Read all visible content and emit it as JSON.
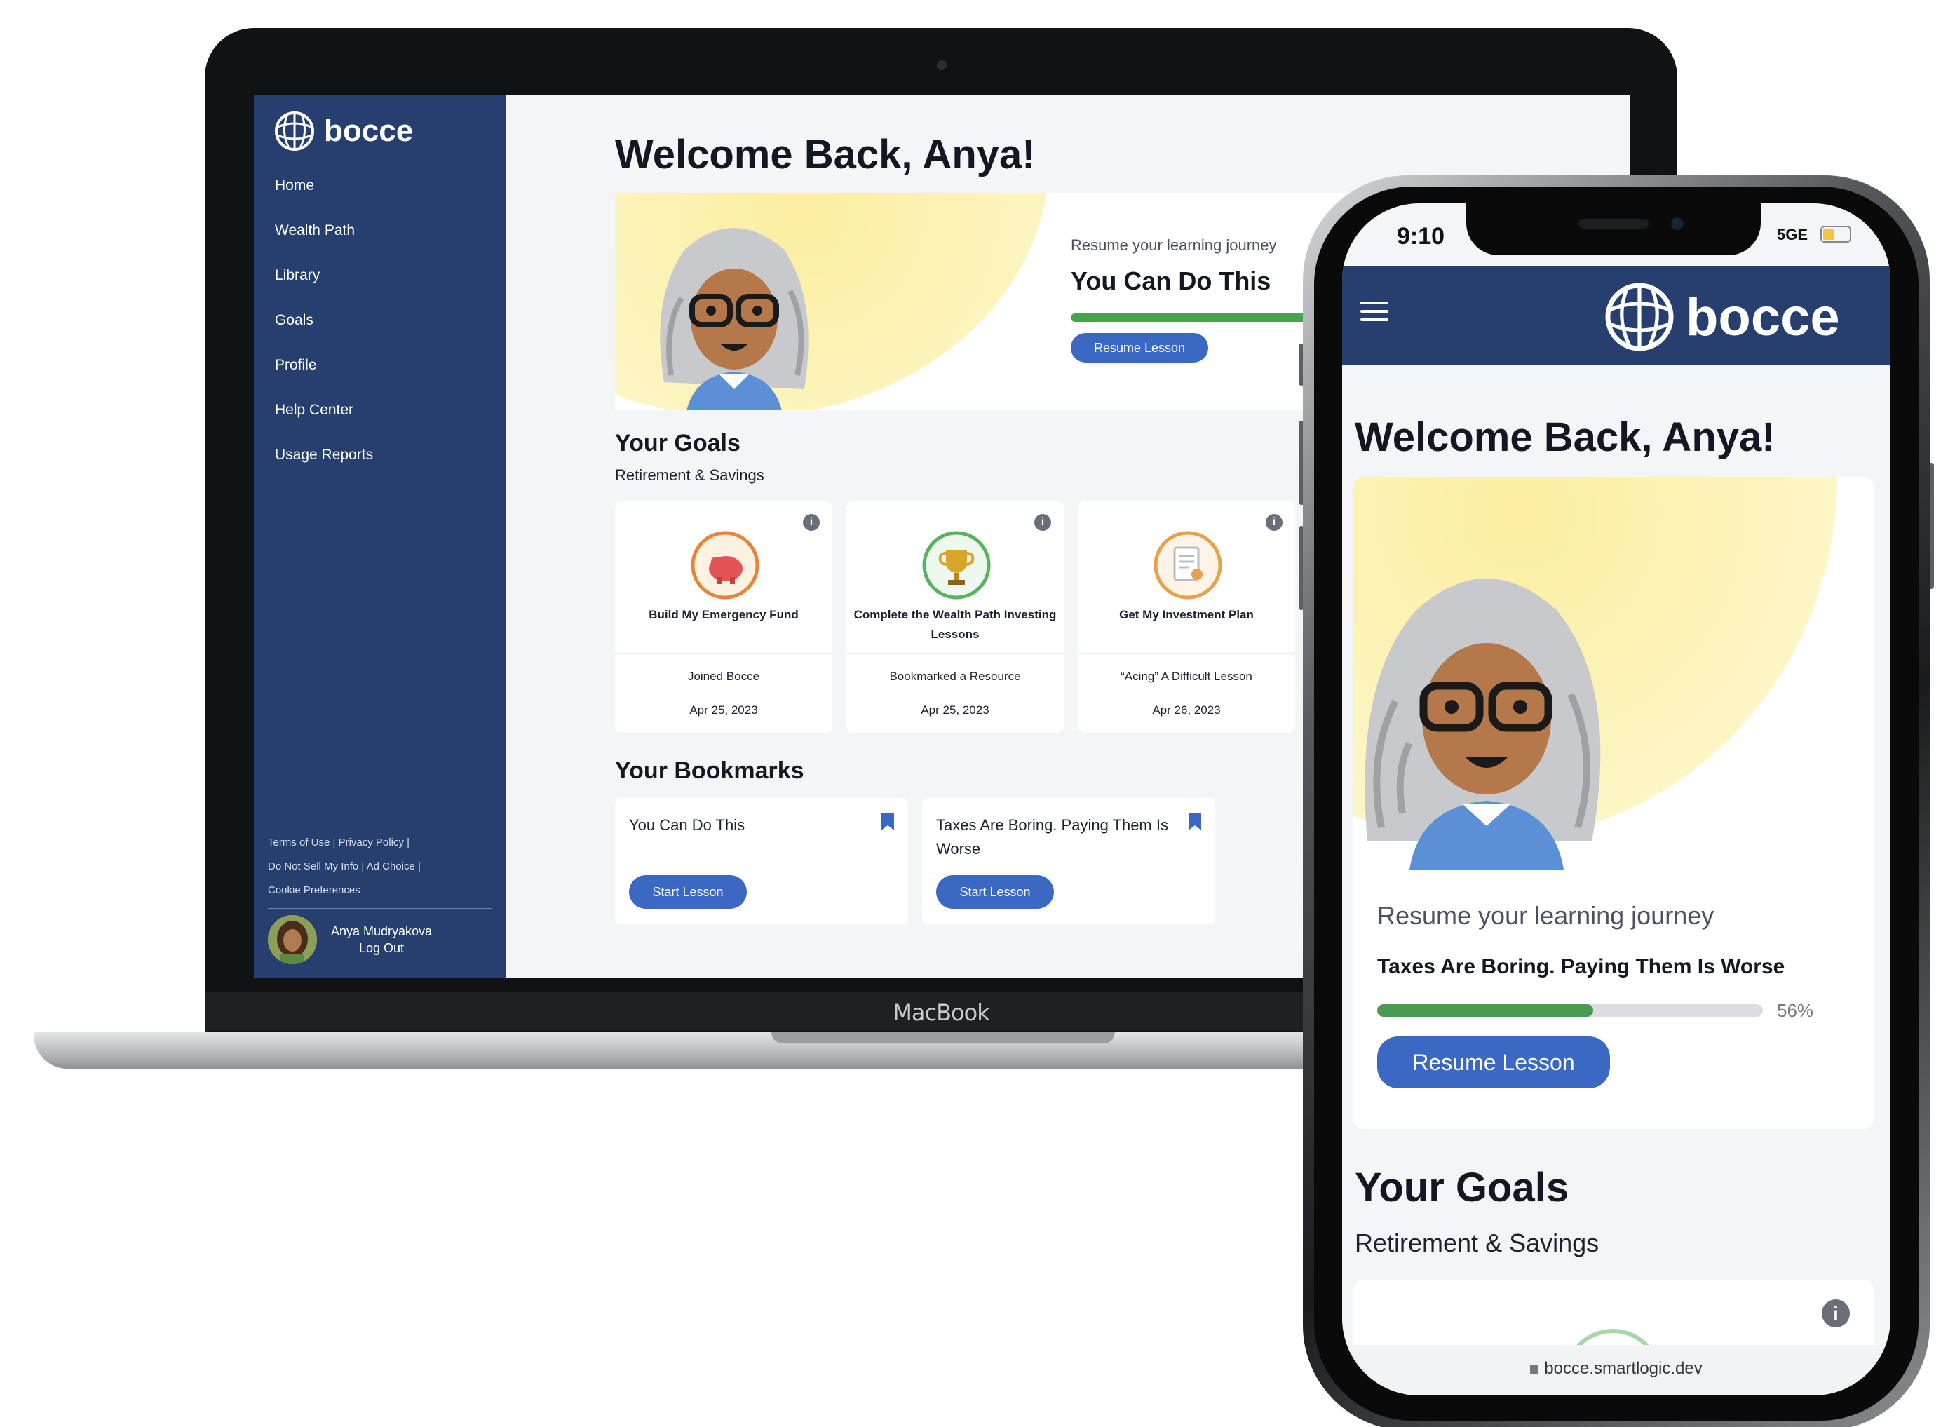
{
  "laptop": {
    "chin_label": "MacBook",
    "sidebar": {
      "logo_text": "bocce",
      "nav": [
        "Home",
        "Wealth Path",
        "Library",
        "Goals",
        "Profile",
        "Help Center",
        "Usage Reports"
      ],
      "legal": {
        "line1": "Terms of Use | Privacy Policy |",
        "line2": "Do Not Sell My Info | Ad Choice |",
        "line3": "Cookie Preferences"
      },
      "user_name": "Anya Mudryakova",
      "logout": "Log Out"
    },
    "main": {
      "welcome": "Welcome Back, Anya!",
      "hero": {
        "subtitle": "Resume your learning journey",
        "title": "You Can Do This",
        "button": "Resume Lesson"
      },
      "goals": {
        "title": "Your Goals",
        "subtitle": "Retirement & Savings",
        "cards": [
          {
            "name": "Build My Emergency Fund",
            "achievement": "Joined Bocce",
            "date": "Apr 25, 2023",
            "icon": "piggy-bank-icon"
          },
          {
            "name": "Complete the Wealth Path Investing Lessons",
            "achievement": "Bookmarked a Resource",
            "date": "Apr 25, 2023",
            "icon": "trophy-icon"
          },
          {
            "name": "Get My Investment Plan",
            "achievement": "“Acing” A Difficult Lesson",
            "date": "Apr 26, 2023",
            "icon": "document-icon"
          }
        ]
      },
      "bookmarks": {
        "title": "Your Bookmarks",
        "items": [
          {
            "title": "You Can Do This",
            "button": "Start Lesson"
          },
          {
            "title": "Taxes Are Boring. Paying Them Is Worse",
            "button": "Start Lesson"
          }
        ]
      }
    }
  },
  "phone": {
    "time": "9:10",
    "network": "5GE",
    "logo_text": "bocce",
    "welcome": "Welcome Back, Anya!",
    "resume": {
      "subtitle": "Resume your learning journey",
      "title": "Taxes Are Boring. Paying Them Is Worse",
      "progress": 56,
      "progress_label": "56%",
      "button": "Resume Lesson"
    },
    "goals_title": "Your Goals",
    "goals_subtitle": "Retirement & Savings",
    "url": "bocce.smartlogic.dev"
  },
  "colors": {
    "brand_navy": "#273f6e",
    "button_blue": "#3b68c2",
    "progress_green": "#46a34e",
    "hero_yellow": "#fbeea0"
  }
}
